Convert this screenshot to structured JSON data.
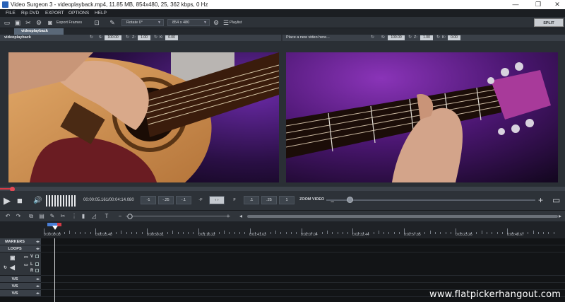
{
  "window": {
    "title": "Video Surgeon 3 - videoplayback.mp4, 11.85 MB, 854x480, 25, 362 kbps, 0 Hz",
    "controls": [
      "—",
      "❐",
      "✕"
    ]
  },
  "menu": [
    "FILE",
    "Rip DVD",
    "EXPORT",
    "OPTIONS",
    "HELP"
  ],
  "toolbar": {
    "export_frames": "Export Frames",
    "rotate": "Rotate 0°",
    "resolution": "854 x 480",
    "playlist": "Playlist",
    "split_screen": "SPLIT SCREEN"
  },
  "tabs": {
    "active": "videoplayback"
  },
  "left_panel": {
    "title": "videoplayback",
    "s_label": "S:",
    "s_value": "100.00",
    "z_label": "Z:",
    "z_value": "1.00",
    "k_label": "K:",
    "k_value": "0.00"
  },
  "right_panel": {
    "title": "Place a new video here...",
    "s_label": "S:",
    "s_value": "100.00",
    "z_label": "Z:",
    "z_value": "1.00",
    "k_label": "K:",
    "k_value": "0.00"
  },
  "playback": {
    "progress": 0.02,
    "time": "00:00:05.161/00:04:14.080",
    "steps": [
      "-1",
      "-.25",
      "-.1",
      "-F",
      "‹ ›",
      "F",
      ".1",
      ".25",
      "1"
    ],
    "zoom_label": "ZOOM VIDEO",
    "zoom_level": 0.05
  },
  "ruler": {
    "labels": [
      "0:00:00.00",
      "0:00:25.40",
      "0:00:50.81",
      "0:01:16.22",
      "0:01:41.63",
      "0:02:07.04",
      "0:02:32.44",
      "0:02:57.85",
      "0:03:23.26",
      "0:03:48.67"
    ]
  },
  "tracks": {
    "markers": "MARKERS",
    "loops": "LOOPS",
    "vs1": "V/S",
    "vs2": "V/S",
    "vs3": "V/S"
  },
  "watermark": "www.flatpickerhangout.com",
  "colors": {
    "accent": "#d33b46",
    "panel": "#3a4048",
    "tab": "#5a6878"
  }
}
